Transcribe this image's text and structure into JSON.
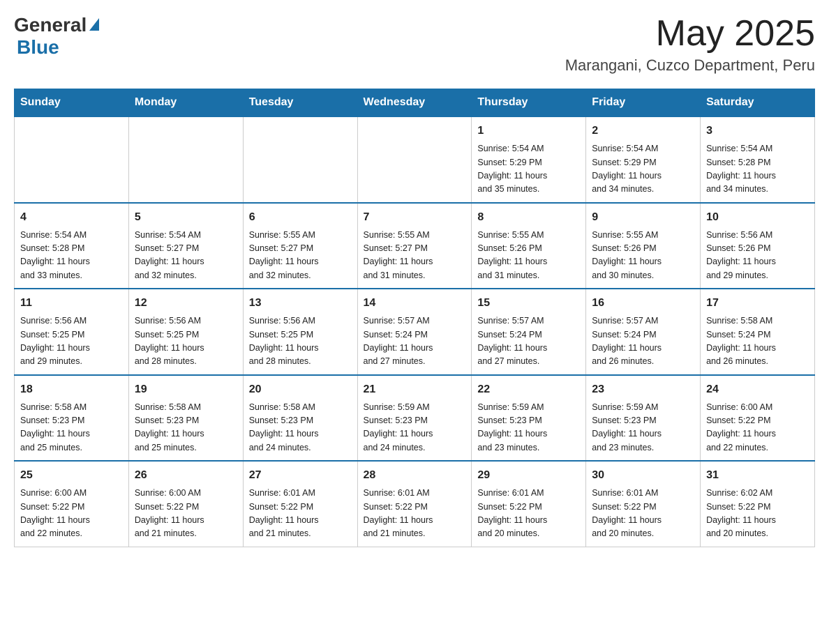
{
  "header": {
    "logo_general": "General",
    "logo_blue": "Blue",
    "month_title": "May 2025",
    "location": "Marangani, Cuzco Department, Peru"
  },
  "days_of_week": [
    "Sunday",
    "Monday",
    "Tuesday",
    "Wednesday",
    "Thursday",
    "Friday",
    "Saturday"
  ],
  "weeks": [
    [
      {
        "day": "",
        "info": ""
      },
      {
        "day": "",
        "info": ""
      },
      {
        "day": "",
        "info": ""
      },
      {
        "day": "",
        "info": ""
      },
      {
        "day": "1",
        "info": "Sunrise: 5:54 AM\nSunset: 5:29 PM\nDaylight: 11 hours\nand 35 minutes."
      },
      {
        "day": "2",
        "info": "Sunrise: 5:54 AM\nSunset: 5:29 PM\nDaylight: 11 hours\nand 34 minutes."
      },
      {
        "day": "3",
        "info": "Sunrise: 5:54 AM\nSunset: 5:28 PM\nDaylight: 11 hours\nand 34 minutes."
      }
    ],
    [
      {
        "day": "4",
        "info": "Sunrise: 5:54 AM\nSunset: 5:28 PM\nDaylight: 11 hours\nand 33 minutes."
      },
      {
        "day": "5",
        "info": "Sunrise: 5:54 AM\nSunset: 5:27 PM\nDaylight: 11 hours\nand 32 minutes."
      },
      {
        "day": "6",
        "info": "Sunrise: 5:55 AM\nSunset: 5:27 PM\nDaylight: 11 hours\nand 32 minutes."
      },
      {
        "day": "7",
        "info": "Sunrise: 5:55 AM\nSunset: 5:27 PM\nDaylight: 11 hours\nand 31 minutes."
      },
      {
        "day": "8",
        "info": "Sunrise: 5:55 AM\nSunset: 5:26 PM\nDaylight: 11 hours\nand 31 minutes."
      },
      {
        "day": "9",
        "info": "Sunrise: 5:55 AM\nSunset: 5:26 PM\nDaylight: 11 hours\nand 30 minutes."
      },
      {
        "day": "10",
        "info": "Sunrise: 5:56 AM\nSunset: 5:26 PM\nDaylight: 11 hours\nand 29 minutes."
      }
    ],
    [
      {
        "day": "11",
        "info": "Sunrise: 5:56 AM\nSunset: 5:25 PM\nDaylight: 11 hours\nand 29 minutes."
      },
      {
        "day": "12",
        "info": "Sunrise: 5:56 AM\nSunset: 5:25 PM\nDaylight: 11 hours\nand 28 minutes."
      },
      {
        "day": "13",
        "info": "Sunrise: 5:56 AM\nSunset: 5:25 PM\nDaylight: 11 hours\nand 28 minutes."
      },
      {
        "day": "14",
        "info": "Sunrise: 5:57 AM\nSunset: 5:24 PM\nDaylight: 11 hours\nand 27 minutes."
      },
      {
        "day": "15",
        "info": "Sunrise: 5:57 AM\nSunset: 5:24 PM\nDaylight: 11 hours\nand 27 minutes."
      },
      {
        "day": "16",
        "info": "Sunrise: 5:57 AM\nSunset: 5:24 PM\nDaylight: 11 hours\nand 26 minutes."
      },
      {
        "day": "17",
        "info": "Sunrise: 5:58 AM\nSunset: 5:24 PM\nDaylight: 11 hours\nand 26 minutes."
      }
    ],
    [
      {
        "day": "18",
        "info": "Sunrise: 5:58 AM\nSunset: 5:23 PM\nDaylight: 11 hours\nand 25 minutes."
      },
      {
        "day": "19",
        "info": "Sunrise: 5:58 AM\nSunset: 5:23 PM\nDaylight: 11 hours\nand 25 minutes."
      },
      {
        "day": "20",
        "info": "Sunrise: 5:58 AM\nSunset: 5:23 PM\nDaylight: 11 hours\nand 24 minutes."
      },
      {
        "day": "21",
        "info": "Sunrise: 5:59 AM\nSunset: 5:23 PM\nDaylight: 11 hours\nand 24 minutes."
      },
      {
        "day": "22",
        "info": "Sunrise: 5:59 AM\nSunset: 5:23 PM\nDaylight: 11 hours\nand 23 minutes."
      },
      {
        "day": "23",
        "info": "Sunrise: 5:59 AM\nSunset: 5:23 PM\nDaylight: 11 hours\nand 23 minutes."
      },
      {
        "day": "24",
        "info": "Sunrise: 6:00 AM\nSunset: 5:22 PM\nDaylight: 11 hours\nand 22 minutes."
      }
    ],
    [
      {
        "day": "25",
        "info": "Sunrise: 6:00 AM\nSunset: 5:22 PM\nDaylight: 11 hours\nand 22 minutes."
      },
      {
        "day": "26",
        "info": "Sunrise: 6:00 AM\nSunset: 5:22 PM\nDaylight: 11 hours\nand 21 minutes."
      },
      {
        "day": "27",
        "info": "Sunrise: 6:01 AM\nSunset: 5:22 PM\nDaylight: 11 hours\nand 21 minutes."
      },
      {
        "day": "28",
        "info": "Sunrise: 6:01 AM\nSunset: 5:22 PM\nDaylight: 11 hours\nand 21 minutes."
      },
      {
        "day": "29",
        "info": "Sunrise: 6:01 AM\nSunset: 5:22 PM\nDaylight: 11 hours\nand 20 minutes."
      },
      {
        "day": "30",
        "info": "Sunrise: 6:01 AM\nSunset: 5:22 PM\nDaylight: 11 hours\nand 20 minutes."
      },
      {
        "day": "31",
        "info": "Sunrise: 6:02 AM\nSunset: 5:22 PM\nDaylight: 11 hours\nand 20 minutes."
      }
    ]
  ]
}
